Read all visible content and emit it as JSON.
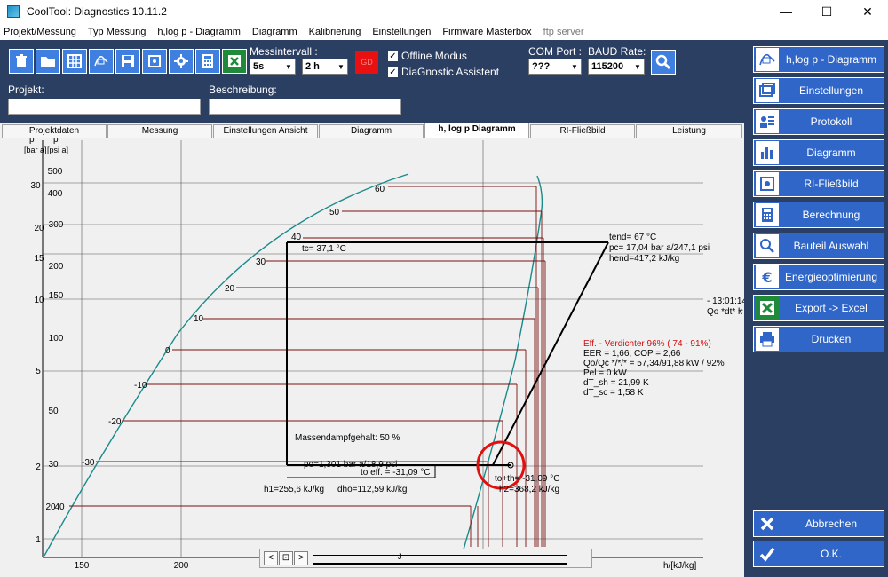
{
  "window": {
    "title": "CoolTool: Diagnostics 10.11.2",
    "minimize": "—",
    "maximize": "☐",
    "close": "✕"
  },
  "menu": [
    "Projekt/Messung",
    "Typ Messung",
    "h,log p - Diagramm",
    "Diagramm",
    "Kalibrierung",
    "Einstellungen",
    "Firmware Masterbox",
    "ftp server"
  ],
  "toolbar": {
    "messintervall_label": "Messintervall :",
    "interval_value": "5s",
    "duration_value": "2 h",
    "gd_label": "GD",
    "offline_label": "Offline Modus",
    "assistant_label": "DiaGnostic Assistent",
    "com_label": "COM Port :",
    "com_value": "???",
    "baud_label": "BAUD Rate:",
    "baud_value": "115200",
    "projekt_label": "Projekt:",
    "beschreibung_label": "Beschreibung:"
  },
  "tabs": [
    "Projektdaten",
    "Messung",
    "Einstellungen Ansicht",
    "Diagramm",
    "h, log p Diagramm",
    "RI-Fließbild",
    "Leistung"
  ],
  "active_tab": "h, log p Diagramm",
  "right_panel": {
    "buttons": [
      "h,log p - Diagramm",
      "Einstellungen",
      "Protokoll",
      "Diagramm",
      "RI-Fließbild",
      "Berechnung",
      "Bauteil Auswahl",
      "Energieoptimierung",
      "Export -> Excel",
      "Drucken"
    ],
    "abbrechen": "Abbrechen",
    "ok": "O.K."
  },
  "chart_data": {
    "type": "line",
    "title": "",
    "xlabel": "h/[kJ/kg]",
    "ylabel_bar": "p",
    "ylabel_psi": "p",
    "unit_bar": "[bar a]",
    "unit_psi": "[psi a]",
    "x_ticks": [
      "150",
      "200"
    ],
    "y_ticks_bar": [
      "30",
      "20",
      "15",
      "10",
      "5",
      "2",
      "1"
    ],
    "y_ticks_psi": [
      "500",
      "400",
      "300",
      "200",
      "150",
      "100",
      "50",
      "30",
      "20",
      "40"
    ],
    "isotherms": [
      "60",
      "50",
      "40",
      "30",
      "20",
      "10",
      "0",
      "-10",
      "-20",
      "-30"
    ],
    "cycle": {
      "tc": "tc=  37,1 °C",
      "tend": "tend= 67 °C",
      "pc": "pc= 17,04 bar a/247,1 psi",
      "hend": "hend=417,2 kJ/kg",
      "massendampf": "Massendampfgehalt:  50 %",
      "po": "po=1,301 bar a/18,9 psi",
      "to": "to eff. = -31,09 °C",
      "h1": "h1=255,6 kJ/kg",
      "dho": "dho=112,59 kJ/kg",
      "toh": "to+th= -31,09 °C",
      "h2": "h2=368,2 kJ/kg"
    },
    "time_label": "- 13:01:14",
    "qo_label": "Qo *dt* =",
    "qo_tail": "k",
    "results": {
      "eff": "Eff. - Verdichter  96% ( 74 -  91%)",
      "eer": "EER = 1,66, COP =  2,66",
      "qo": "Qo/Qc */*/* = 57,34/91,88 kW / 92%",
      "pel": "Pel =  0 kW",
      "dt_sh": "dT_sh = 21,99 K",
      "dt_sc": "dT_sc = 1,58 K"
    }
  },
  "navigator": {
    "prev": "<",
    "home": "⊡",
    "next": ">",
    "marker": "J"
  }
}
